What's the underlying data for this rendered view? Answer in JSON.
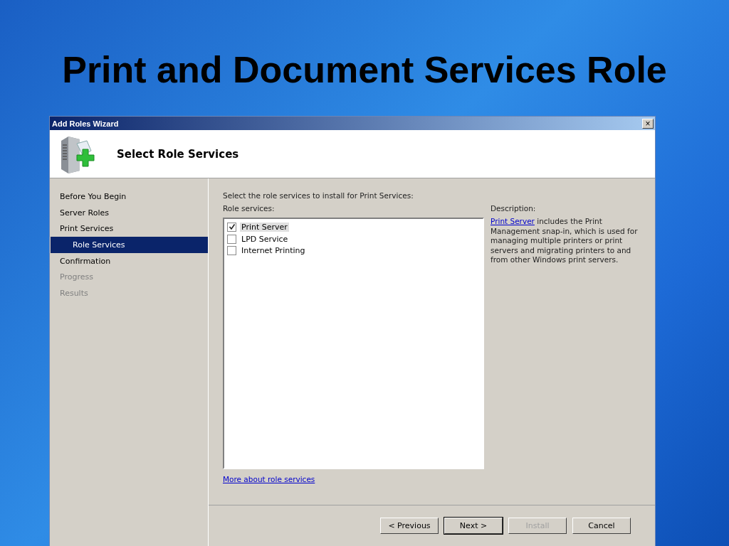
{
  "slide_title": "Print and Document Services Role",
  "window": {
    "title": "Add Roles Wizard",
    "close": "×",
    "heading": "Select Role Services"
  },
  "nav": [
    {
      "label": "Before You Begin",
      "selected": false,
      "disabled": false
    },
    {
      "label": "Server Roles",
      "selected": false,
      "disabled": false
    },
    {
      "label": "Print Services",
      "selected": false,
      "disabled": false,
      "children": [
        {
          "label": "Role Services",
          "selected": true,
          "disabled": false
        }
      ]
    },
    {
      "label": "Confirmation",
      "selected": false,
      "disabled": false
    },
    {
      "label": "Progress",
      "selected": false,
      "disabled": true
    },
    {
      "label": "Results",
      "selected": false,
      "disabled": true
    }
  ],
  "instruction": "Select the role services to install for Print Services:",
  "list_label": "Role services:",
  "services": [
    {
      "label": "Print Server",
      "checked": true,
      "selected": true
    },
    {
      "label": "LPD Service",
      "checked": false,
      "selected": false
    },
    {
      "label": "Internet Printing",
      "checked": false,
      "selected": false
    }
  ],
  "description": {
    "label": "Description:",
    "link": "Print Server",
    "text": " includes the Print Management snap-in, which is used for managing multiple printers or print servers and migrating printers to and from other Windows print servers."
  },
  "more_link": "More about role services",
  "buttons": [
    {
      "label": "< Previous",
      "disabled": false,
      "default": false
    },
    {
      "label": "Next >",
      "disabled": false,
      "default": true
    },
    {
      "label": "Install",
      "disabled": true,
      "default": false
    },
    {
      "label": "Cancel",
      "disabled": false,
      "default": false
    }
  ]
}
